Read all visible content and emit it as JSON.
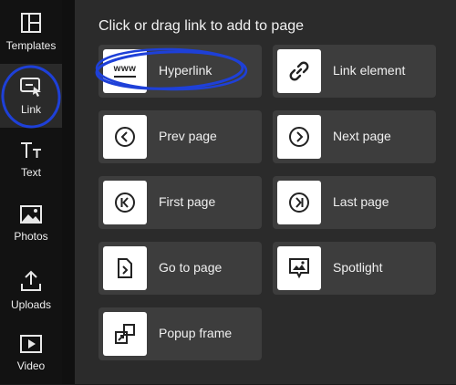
{
  "sidebar": {
    "items": [
      {
        "label": "Templates",
        "icon": "templates-icon"
      },
      {
        "label": "Link",
        "icon": "link-icon"
      },
      {
        "label": "Text",
        "icon": "text-icon"
      },
      {
        "label": "Photos",
        "icon": "photos-icon"
      },
      {
        "label": "Uploads",
        "icon": "uploads-icon"
      },
      {
        "label": "Video",
        "icon": "video-icon"
      }
    ],
    "active": "Link"
  },
  "panel": {
    "title": "Click or drag link to add to page",
    "cards": [
      {
        "label": "Hyperlink",
        "icon": "www-icon",
        "icon_text": "www"
      },
      {
        "label": "Link element",
        "icon": "chain-link-icon"
      },
      {
        "label": "Prev page",
        "icon": "chevron-left-circle-icon"
      },
      {
        "label": "Next page",
        "icon": "chevron-right-circle-icon"
      },
      {
        "label": "First page",
        "icon": "first-page-icon"
      },
      {
        "label": "Last page",
        "icon": "last-page-icon"
      },
      {
        "label": "Go to page",
        "icon": "go-to-page-icon"
      },
      {
        "label": "Spotlight",
        "icon": "spotlight-icon"
      },
      {
        "label": "Popup frame",
        "icon": "popup-frame-icon"
      }
    ]
  },
  "colors": {
    "annotation": "#1e40d8",
    "sidebar_bg": "#121212",
    "panel_bg": "#2b2b2b",
    "card_bg": "#3d3d3d"
  }
}
